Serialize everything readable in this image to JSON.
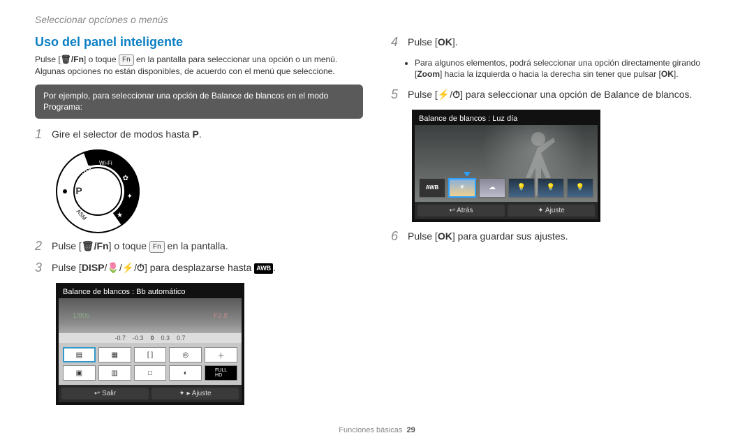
{
  "breadcrumb": "Seleccionar opciones o menús",
  "title": "Uso del panel inteligente",
  "intro_line1_a": "Pulse [",
  "intro_line1_trashfn": "🗑/Fn",
  "intro_line1_b": "] o toque ",
  "intro_fn_key": "Fn",
  "intro_line1_c": " en la pantalla para seleccionar una opción o un menú.",
  "intro_line2": "Algunas opciones no están disponibles, de acuerdo con el menú que seleccione.",
  "example_box": "Por ejemplo, para seleccionar una opción de Balance de blancos en el modo Programa:",
  "left_steps": {
    "s1": {
      "num": "1",
      "text_a": "Gire el selector de modos hasta ",
      "mode": "P",
      "text_b": "."
    },
    "s2": {
      "num": "2",
      "text_a": "Pulse [",
      "trashfn": "🗑/Fn",
      "text_b": "] o toque ",
      "fn": "Fn",
      "text_c": " en la pantalla."
    },
    "s3": {
      "num": "3",
      "text_a": "Pulse [",
      "disp": "DISP",
      "slash1": "/",
      "macro": "🌷",
      "slash2": "/",
      "flash": "⚡",
      "slash3": "/",
      "timer": "⏱",
      "text_b": "] para desplazarse hasta ",
      "awb_badge": "AWB",
      "text_c": "."
    }
  },
  "mode_dial": {
    "selected": "P",
    "auto": "AUTO",
    "wifi": "Wi-Fi",
    "asm": "ASM"
  },
  "cam1": {
    "title": "Balance de blancos : Bb automático",
    "topinfo_left": "1/80s",
    "topinfo_right": "F2.8",
    "scale": [
      "-0.7",
      "-0.3",
      "0",
      "0.3",
      "0.7"
    ],
    "footer_left": "↩ Salir",
    "footer_right": "✦ ▸ Ajuste"
  },
  "right_steps": {
    "s4": {
      "num": "4",
      "text_a": "Pulse [",
      "ok": "OK",
      "text_b": "]."
    },
    "s4_sub_a": "Para algunos elementos, podrá seleccionar una opción directamente girando [",
    "s4_sub_zoom": "Zoom",
    "s4_sub_b": "] hacia la izquierda o hacia la derecha sin tener que pulsar [",
    "s4_sub_ok": "OK",
    "s4_sub_c": "].",
    "s5": {
      "num": "5",
      "text_a": "Pulse [",
      "flash": "⚡",
      "slash": "/",
      "timer": "⏱",
      "text_b": "] para seleccionar una opción de Balance de blancos."
    },
    "s6": {
      "num": "6",
      "text_a": "Pulse [",
      "ok": "OK",
      "text_b": "] para guardar sus ajustes."
    }
  },
  "cam2": {
    "title": "Balance de blancos : Luz día",
    "options": [
      "AWB",
      "☀",
      "☁",
      "💡",
      "💡",
      "💡"
    ],
    "selected_index": 1,
    "footer_left": "↩ Atrás",
    "footer_right": "✦ Ajuste"
  },
  "footer_label": "Funciones básicas",
  "page_number": "29"
}
